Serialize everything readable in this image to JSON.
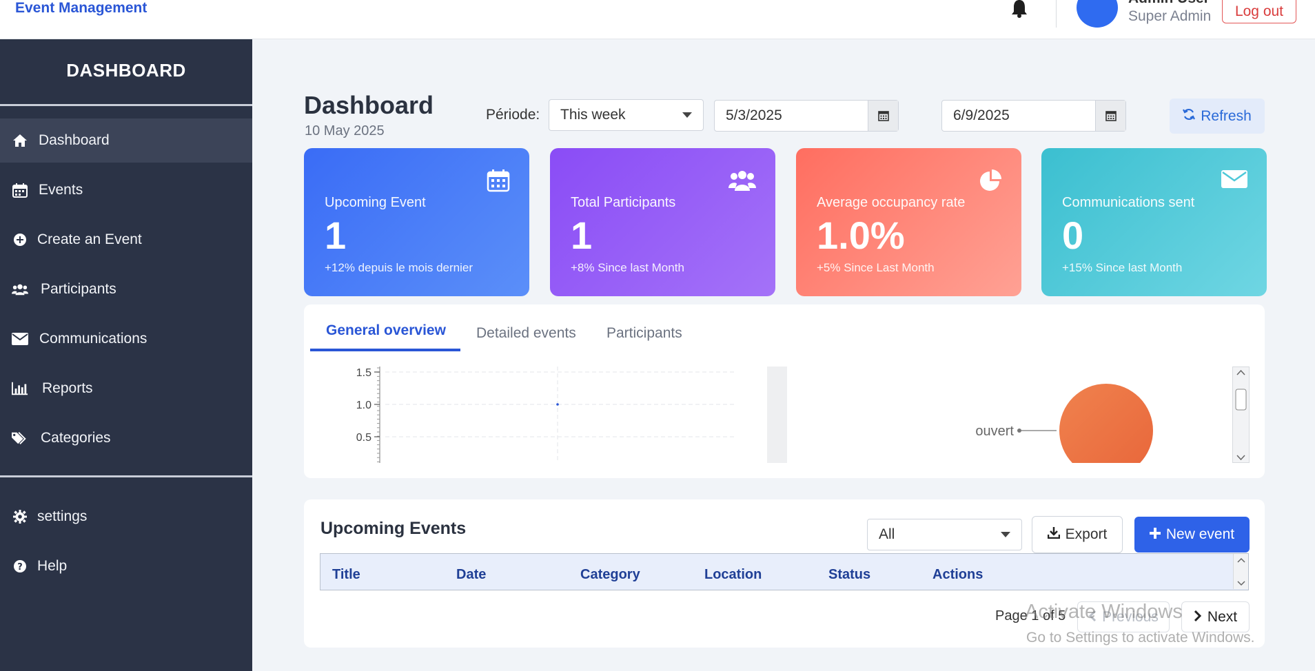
{
  "header": {
    "brand": "Event Management",
    "user_name": "Admin User",
    "user_role": "Super Admin",
    "logout_label": "Log out"
  },
  "sidebar": {
    "title": "DASHBOARD",
    "items": [
      {
        "label": "Dashboard",
        "icon": "home-icon"
      },
      {
        "label": "Events",
        "icon": "calendar-icon"
      },
      {
        "label": "Create an Event",
        "icon": "plus-circle-icon"
      },
      {
        "label": "Participants",
        "icon": "users-icon"
      },
      {
        "label": "Communications",
        "icon": "envelope-icon"
      },
      {
        "label": "Reports",
        "icon": "bar-chart-icon"
      },
      {
        "label": "Categories",
        "icon": "tags-icon"
      }
    ],
    "bottom_items": [
      {
        "label": "settings",
        "icon": "gear-icon"
      },
      {
        "label": "Help",
        "icon": "question-circle-icon"
      }
    ]
  },
  "main": {
    "title": "Dashboard",
    "date": "10 May 2025",
    "period_label": "Période:",
    "period_value": "This week",
    "start_date": "5/3/2025",
    "end_date": "6/9/2025",
    "refresh_label": "Refresh"
  },
  "cards": [
    {
      "label": "Upcoming Event",
      "value": "1",
      "note": "+12% depuis le mois dernier",
      "icon": "calendar-icon",
      "color_from": "#3a6cf6",
      "color_to": "#5b8ff9"
    },
    {
      "label": "Total Participants",
      "value": "1",
      "note": "+8% Since last Month",
      "icon": "users-icon",
      "color_from": "#8a4cf6",
      "color_to": "#a472f8"
    },
    {
      "label": "Average occupancy rate",
      "value": "1.0%",
      "note": "+5% Since Last Month",
      "icon": "pie-chart-icon",
      "color_from": "#ff6e60",
      "color_to": "#ffa194"
    },
    {
      "label": "Communications sent",
      "value": "0",
      "note": "+15% Since last Month",
      "icon": "envelope-icon",
      "color_from": "#3bbfd0",
      "color_to": "#6fd6e3"
    }
  ],
  "tabs": [
    "General overview",
    "Detailed events",
    "Participants"
  ],
  "chart_data": [
    {
      "type": "line",
      "y_ticks": [
        "1.5",
        "1.0",
        "0.5"
      ],
      "series": [
        {
          "values": [
            1.0
          ]
        }
      ],
      "grid": true
    },
    {
      "type": "pie",
      "slices": [
        {
          "label": "ouvert",
          "value": 1
        }
      ],
      "colors": [
        "#e8663a"
      ]
    }
  ],
  "events": {
    "title": "Upcoming Events",
    "filter_value": "All",
    "export_label": "Export",
    "new_event_label": "New event",
    "columns": [
      "Title",
      "Date",
      "Category",
      "Location",
      "Status",
      "Actions"
    ],
    "page_text": "Page 1 of 5",
    "previous_label": "Previous",
    "next_label": "Next"
  },
  "watermark": {
    "line1": "Activate Windows",
    "line2": "Go to Settings to activate Windows."
  }
}
